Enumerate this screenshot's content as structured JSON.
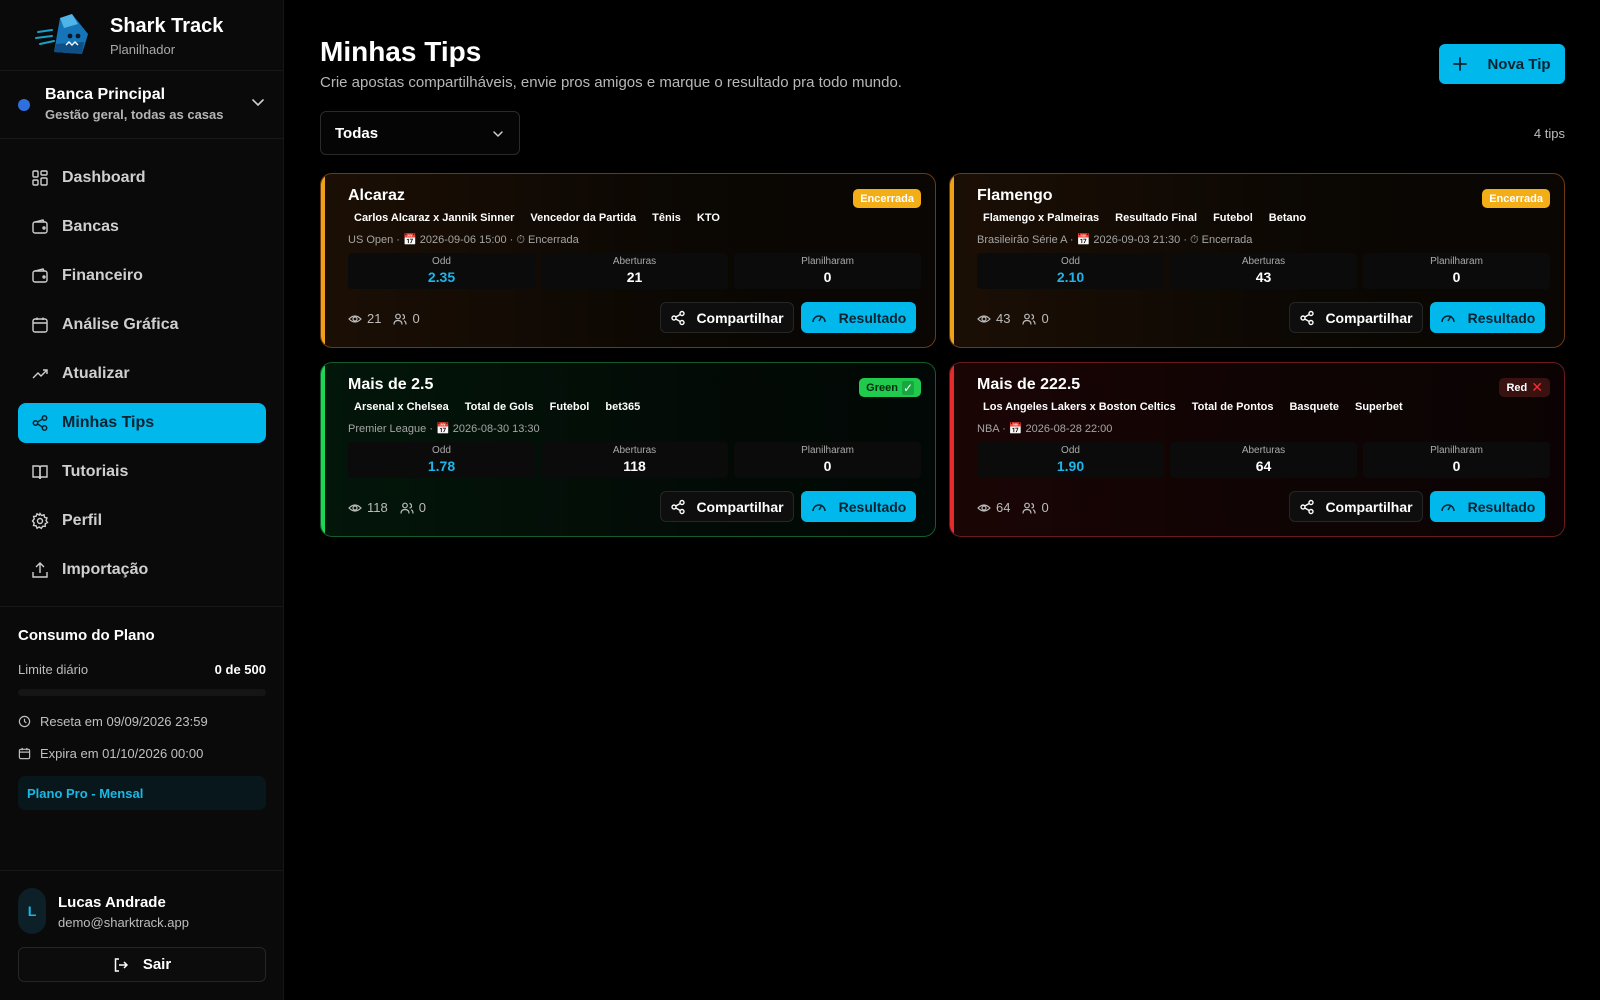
{
  "brand": {
    "name": "Shark Track",
    "subtitle": "Planilhador"
  },
  "bank": {
    "name": "Banca Principal",
    "description": "Gestão geral, todas as casas"
  },
  "nav": {
    "items": [
      {
        "label": "Dashboard",
        "icon": "grid-icon"
      },
      {
        "label": "Bancas",
        "icon": "wallet-icon"
      },
      {
        "label": "Financeiro",
        "icon": "wallet-icon"
      },
      {
        "label": "Análise Gráfica",
        "icon": "calendar-icon"
      },
      {
        "label": "Atualizar",
        "icon": "trending-up-icon"
      },
      {
        "label": "Minhas Tips",
        "icon": "share-icon",
        "active": true
      },
      {
        "label": "Tutoriais",
        "icon": "book-icon"
      },
      {
        "label": "Perfil",
        "icon": "gear-icon"
      },
      {
        "label": "Importação",
        "icon": "upload-icon"
      }
    ]
  },
  "plan": {
    "title": "Consumo do Plano",
    "limit_label": "Limite diário",
    "limit_value": "0 de 500",
    "usage_fraction": 0,
    "reset": "Reseta em 09/09/2026 23:59",
    "expire": "Expira em 01/10/2026 00:00",
    "badge": "Plano Pro - Mensal"
  },
  "user": {
    "initial": "L",
    "name": "Lucas Andrade",
    "email": "demo@sharktrack.app",
    "logout": "Sair"
  },
  "main": {
    "title": "Minhas Tips",
    "subtitle": "Crie apostas compartilháveis, envie pros amigos e marque o resultado pra todo mundo.",
    "new_button": "Nova Tip",
    "filter_value": "Todas",
    "count": "4 tips"
  },
  "labels": {
    "odd": "Odd",
    "aberturas": "Aberturas",
    "planilharam": "Planilharam",
    "share": "Compartilhar",
    "result": "Resultado"
  },
  "colors": {
    "accent": "#00b8ec",
    "orange": "#f0a217",
    "green": "#1ed55a",
    "red": "#e52b2b"
  },
  "tips": [
    {
      "title": "Alcaraz",
      "status": "Encerrada",
      "tags": [
        "Carlos Alcaraz x Jannik Sinner",
        "Vencedor da Partida",
        "Tênis",
        "KTO"
      ],
      "meta": "US Open · 📅 2026-09-06 15:00 · ⏱ Encerrada",
      "odd": "2.35",
      "aberturas": "21",
      "planilharam": "0",
      "views": "21",
      "users": "0"
    },
    {
      "title": "Flamengo",
      "status": "Encerrada",
      "tags": [
        "Flamengo x Palmeiras",
        "Resultado Final",
        "Futebol",
        "Betano"
      ],
      "meta": "Brasileirão Série A · 📅 2026-09-03 21:30 · ⏱ Encerrada",
      "odd": "2.10",
      "aberturas": "43",
      "planilharam": "0",
      "views": "43",
      "users": "0"
    },
    {
      "title": "Mais de 2.5",
      "status": "Green",
      "status_mark": "✓",
      "tags": [
        "Arsenal x Chelsea",
        "Total de Gols",
        "Futebol",
        "bet365"
      ],
      "meta": "Premier League · 📅 2026-08-30 13:30",
      "odd": "1.78",
      "aberturas": "118",
      "planilharam": "0",
      "views": "118",
      "users": "0"
    },
    {
      "title": "Mais de 222.5",
      "status": "Red",
      "status_mark": "✕",
      "tags": [
        "Los Angeles Lakers x Boston Celtics",
        "Total de Pontos",
        "Basquete",
        "Superbet"
      ],
      "meta": "NBA · 📅 2026-08-28 22:00",
      "odd": "1.90",
      "aberturas": "64",
      "planilharam": "0",
      "views": "64",
      "users": "0"
    }
  ]
}
